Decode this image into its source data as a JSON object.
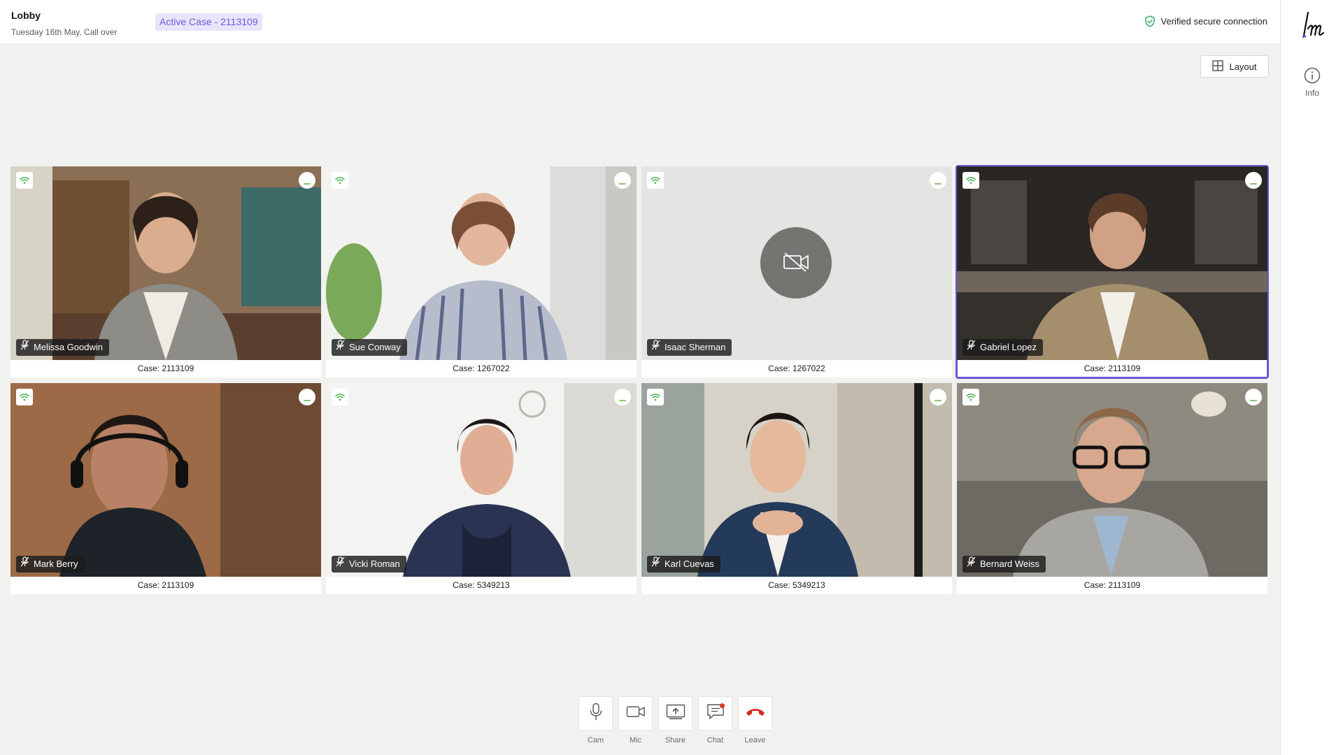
{
  "header": {
    "title": "Lobby",
    "subtitle": "Tuesday 16th May, Call over",
    "active_case": "Active Case - 2113109",
    "secure_text": "Verified secure connection"
  },
  "toolbar": {
    "layout_label": "Layout"
  },
  "rail": {
    "info_label": "Info"
  },
  "participants": [
    {
      "name": "Melissa Goodwin",
      "case": "Case: 2113109"
    },
    {
      "name": "Sue Conway",
      "case": "Case: 1267022"
    },
    {
      "name": "Isaac Sherman",
      "case": "Case: 1267022"
    },
    {
      "name": "Gabriel Lopez",
      "case": "Case: 2113109"
    },
    {
      "name": "Mark Berry",
      "case": "Case: 2113109"
    },
    {
      "name": "Vicki Roman",
      "case": "Case: 5349213"
    },
    {
      "name": "Karl Cuevas",
      "case": "Case: 5349213"
    },
    {
      "name": "Bernard Weiss",
      "case": "Case: 2113109"
    }
  ],
  "controls": [
    {
      "label": "Cam",
      "icon": "microphone-icon"
    },
    {
      "label": "Mic",
      "icon": "video-camera-icon"
    },
    {
      "label": "Share",
      "icon": "share-screen-icon"
    },
    {
      "label": "Chat",
      "icon": "chat-icon"
    },
    {
      "label": "Leave",
      "icon": "hang-up-icon"
    }
  ],
  "colors": {
    "accent": "#6a57d9",
    "badge_bg": "#e8e4fb",
    "secure_green": "#34b36a",
    "leave_red": "#d42a20"
  }
}
